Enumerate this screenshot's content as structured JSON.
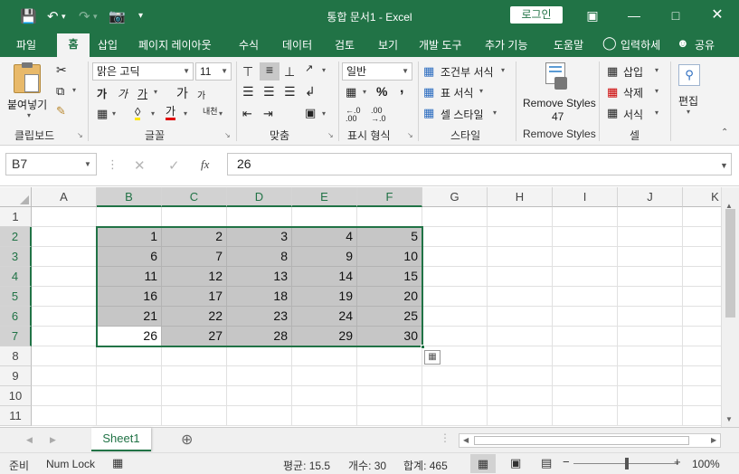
{
  "window": {
    "title": "통합 문서1 - Excel",
    "login_label": "로그인"
  },
  "tabs": [
    {
      "label": "파일"
    },
    {
      "label": "홈"
    },
    {
      "label": "삽입"
    },
    {
      "label": "페이지 레이아웃"
    },
    {
      "label": "수식"
    },
    {
      "label": "데이터"
    },
    {
      "label": "검토"
    },
    {
      "label": "보기"
    },
    {
      "label": "개발 도구"
    },
    {
      "label": "추가 기능"
    },
    {
      "label": "도움말"
    },
    {
      "label": "입력하세"
    },
    {
      "label": "공유"
    }
  ],
  "ribbon": {
    "clipboard": {
      "paste_label": "붙여넣기",
      "group_label": "클립보드"
    },
    "font": {
      "font_name": "맑은 고딕",
      "font_size": "11",
      "bold": "가",
      "italic": "가",
      "underline": "가",
      "grow": "가",
      "shrink": "가",
      "font_color": "가",
      "phonetic": "내천",
      "group_label": "글꼴"
    },
    "alignment": {
      "group_label": "맞춤"
    },
    "number": {
      "format": "일반",
      "percent": "%",
      "comma": ",",
      "group_label": "표시 형식"
    },
    "styles": {
      "conditional": "조건부 서식",
      "table": "표 서식",
      "cell_styles": "셀 스타일",
      "group_label": "스타일"
    },
    "remove_styles": {
      "label_line1": "Remove Styles",
      "label_line2": "47",
      "group_label": "Remove Styles"
    },
    "cells": {
      "insert": "삽입",
      "delete": "삭제",
      "format": "서식",
      "group_label": "셀"
    },
    "editing": {
      "label": "편집"
    }
  },
  "formula_bar": {
    "name_box": "B7",
    "fx": "fx",
    "formula": "26"
  },
  "columns": [
    "A",
    "B",
    "C",
    "D",
    "E",
    "F",
    "G",
    "H",
    "I",
    "J",
    "K"
  ],
  "rows": [
    "1",
    "2",
    "3",
    "4",
    "5",
    "6",
    "7",
    "8",
    "9",
    "10",
    "11"
  ],
  "cells": [
    [
      "1",
      "2",
      "3",
      "4",
      "5"
    ],
    [
      "6",
      "7",
      "8",
      "9",
      "10"
    ],
    [
      "11",
      "12",
      "13",
      "14",
      "15"
    ],
    [
      "16",
      "17",
      "18",
      "19",
      "20"
    ],
    [
      "21",
      "22",
      "23",
      "24",
      "25"
    ],
    [
      "26",
      "27",
      "28",
      "29",
      "30"
    ]
  ],
  "sheets": [
    {
      "name": "Sheet1"
    }
  ],
  "status_bar": {
    "mode": "준비",
    "num_lock": "Num Lock",
    "average": "평균: 15.5",
    "count": "개수: 30",
    "sum": "합계: 465",
    "zoom": "100%"
  },
  "colors": {
    "accent": "#217346",
    "selection": "#c6c6c6"
  }
}
